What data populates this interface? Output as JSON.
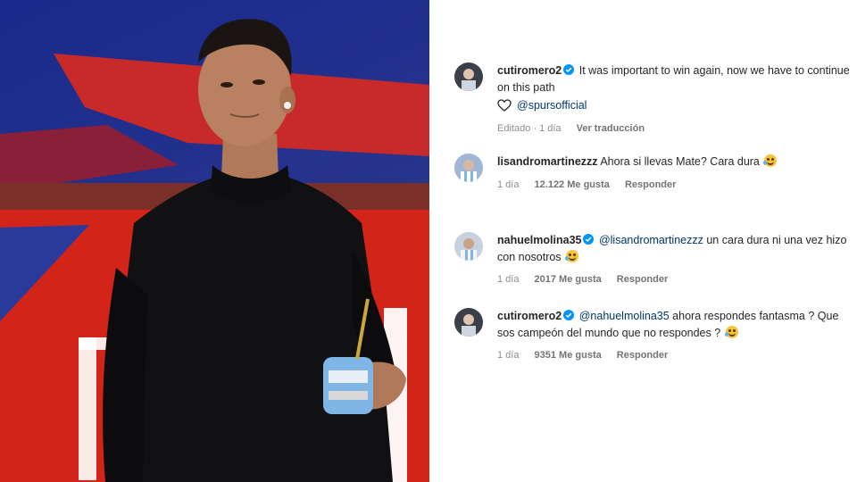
{
  "photo": {
    "description_icon": "player-photo"
  },
  "comments": [
    {
      "username": "cutiromero2",
      "text": "It was important to win again, now we have to continue on this path",
      "tag": "@spursofficial",
      "meta": {
        "edited": "Editado · 1 día",
        "translate": "Ver traducción"
      }
    },
    {
      "username": "lisandromartinezzz",
      "text": "Ahora si llevas Mate? Cara dura",
      "meta": {
        "time": "1 día",
        "likes": "12.122 Me gusta",
        "reply": "Responder"
      }
    },
    {
      "username": "nahuelmolina35",
      "mention": "@lisandromartinezzz",
      "text": "un cara dura ni una vez hizo con nosotros",
      "meta": {
        "time": "1 día",
        "likes": "2017 Me gusta",
        "reply": "Responder"
      }
    },
    {
      "username": "cutiromero2",
      "mention": "@nahuelmolina35",
      "text": "ahora respondes fantasma ? Que sos campeón del mundo que no respondes ?",
      "meta": {
        "time": "1 día",
        "likes": "9351 Me gusta",
        "reply": "Responder"
      }
    }
  ],
  "colors": {
    "mention": "#00376b",
    "meta": "#8e8e8e",
    "verified": "#0095f6"
  }
}
